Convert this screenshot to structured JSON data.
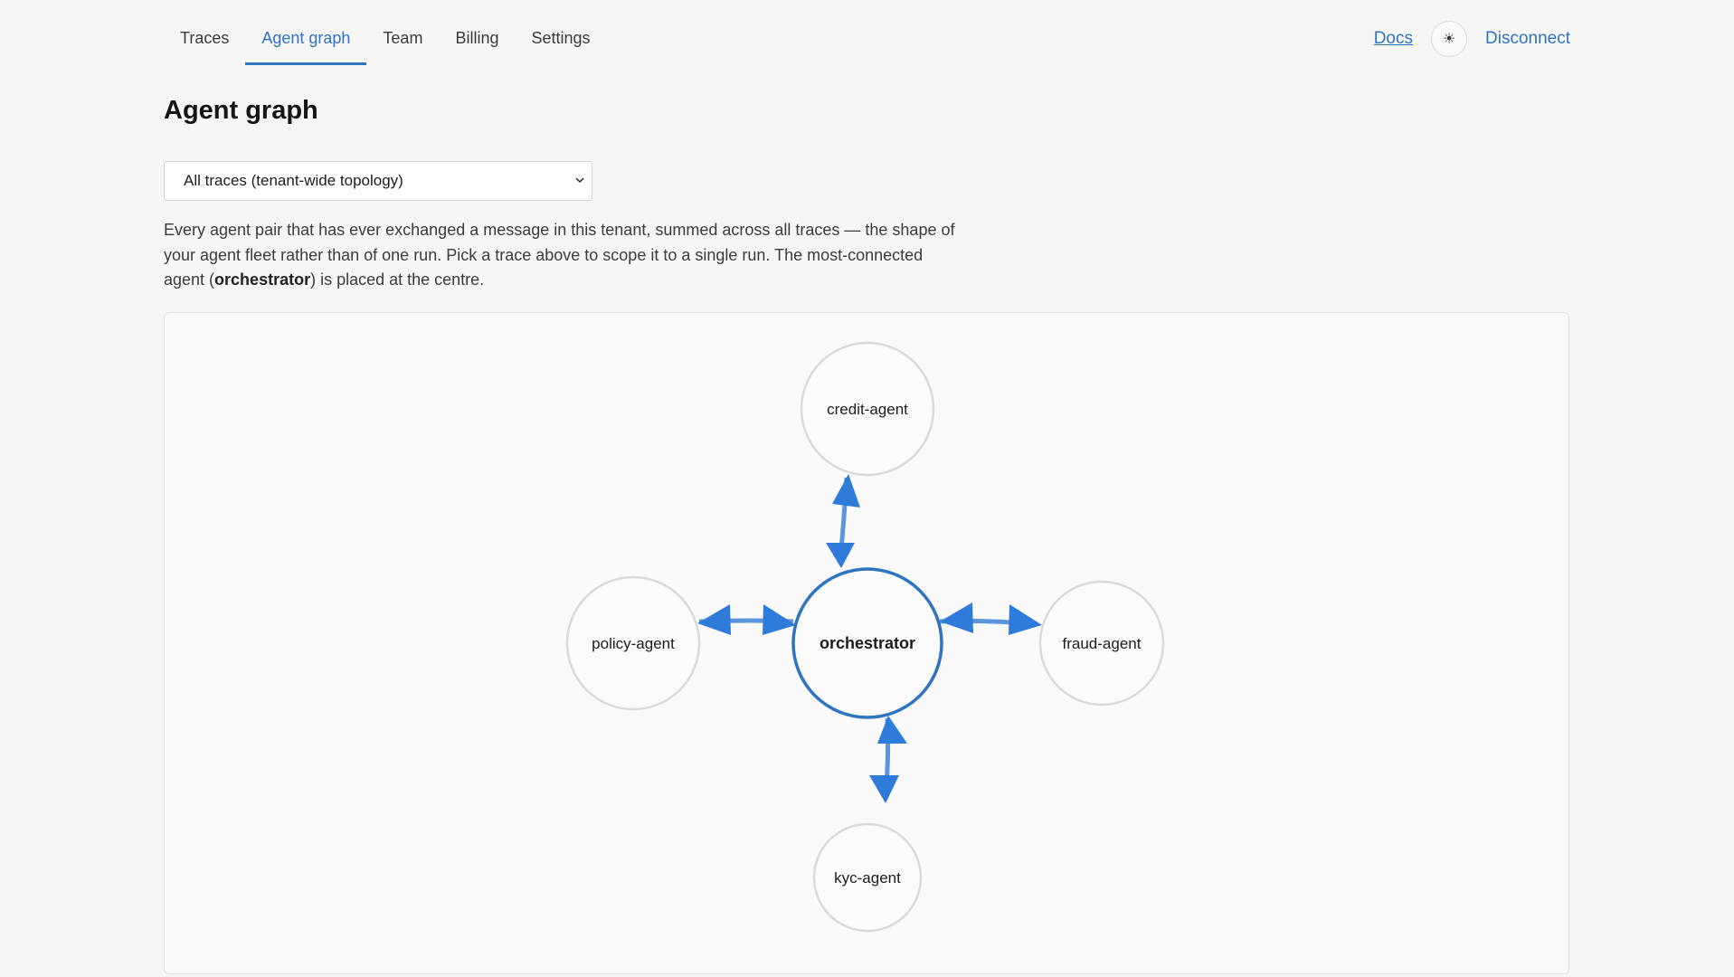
{
  "nav": {
    "tabs": [
      {
        "label": "Traces",
        "active": false
      },
      {
        "label": "Agent graph",
        "active": true
      },
      {
        "label": "Team",
        "active": false
      },
      {
        "label": "Billing",
        "active": false
      },
      {
        "label": "Settings",
        "active": false
      }
    ],
    "docs_label": "Docs",
    "theme_icon": "sun-icon",
    "theme_glyph": "☀",
    "disconnect_label": "Disconnect"
  },
  "page": {
    "title": "Agent graph",
    "select_value": "All traces (tenant-wide topology)",
    "description_before": "Every agent pair that has ever exchanged a message in this tenant, summed across all traces — the shape of your agent fleet rather than of one run. Pick a trace above to scope it to a single run. The most-connected agent (",
    "description_bold": "orchestrator",
    "description_after": ") is placed at the centre."
  },
  "graph": {
    "center_node": "orchestrator",
    "nodes": [
      "credit-agent",
      "policy-agent",
      "orchestrator",
      "fraud-agent",
      "kyc-agent"
    ],
    "edges": [
      {
        "from": "orchestrator",
        "to": "credit-agent",
        "bidirectional": true
      },
      {
        "from": "orchestrator",
        "to": "policy-agent",
        "bidirectional": true
      },
      {
        "from": "orchestrator",
        "to": "fraud-agent",
        "bidirectional": true
      },
      {
        "from": "orchestrator",
        "to": "kyc-agent",
        "bidirectional": true
      }
    ]
  },
  "colors": {
    "accent": "#2f74c0",
    "edge": "#2e7bd9",
    "node_border": "#dadada",
    "center_border": "#2f74c0"
  }
}
